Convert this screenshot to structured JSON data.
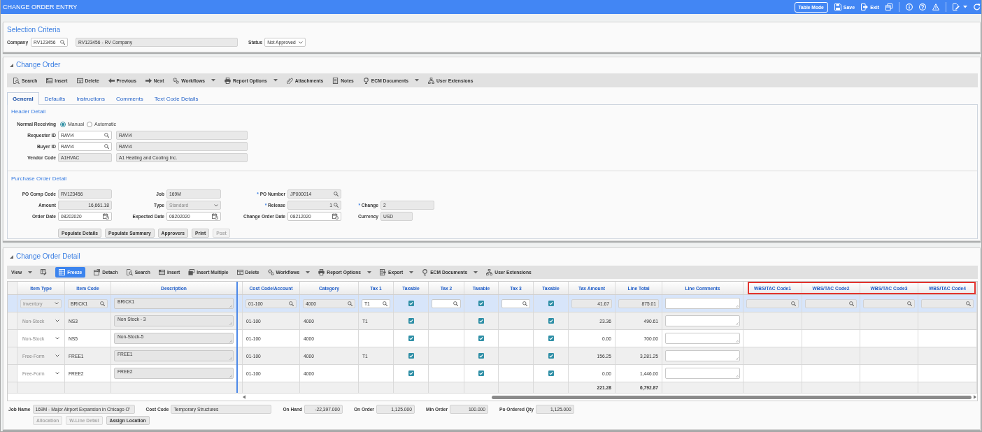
{
  "window": {
    "title": "CHANGE ORDER ENTRY"
  },
  "top_bar": {
    "buttons": [
      {
        "kind": "outlined",
        "label": "Table Mode"
      },
      {
        "kind": "icon-text",
        "label": "Save"
      },
      {
        "kind": "icon-text",
        "label": "Exit"
      }
    ]
  },
  "selection_criteria": {
    "title": "Selection Criteria",
    "company": {
      "label": "Company",
      "value": "RV123456",
      "description": "RV123456 - RV Company"
    },
    "status": {
      "label": "Status",
      "value": "Not Approved"
    }
  },
  "change_order": {
    "title": "Change Order",
    "expanded": true,
    "toolbar": [
      {
        "label": "Search",
        "dropdown": false
      },
      {
        "label": "Insert",
        "dropdown": false
      },
      {
        "label": "Delete",
        "dropdown": false
      },
      {
        "label": "Previous",
        "dropdown": false
      },
      {
        "label": "Next",
        "dropdown": false
      },
      {
        "label": "Workflows",
        "dropdown": true
      },
      {
        "label": "Report Options",
        "dropdown": true
      },
      {
        "label": "Attachments",
        "dropdown": false
      },
      {
        "label": "Notes",
        "dropdown": false
      },
      {
        "label": "ECM Documents",
        "dropdown": true
      },
      {
        "label": "User Extensions",
        "dropdown": false
      }
    ],
    "tabs": [
      {
        "label": "General",
        "selected": true
      },
      {
        "label": "Defaults",
        "selected": false
      },
      {
        "label": "Instructions",
        "selected": false
      },
      {
        "label": "Comments",
        "selected": false
      },
      {
        "label": "Text Code Details",
        "selected": false
      }
    ],
    "header_detail": {
      "title": "Header Detail",
      "normal_receiving": {
        "label": "Normal Receiving",
        "options": [
          {
            "label": "Manual",
            "selected": true
          },
          {
            "label": "Automatic",
            "selected": false
          }
        ]
      },
      "fields": [
        {
          "label": "Requester ID",
          "value": "RAVI4",
          "kind": "lookup",
          "readonly": false,
          "description": "RAVI4"
        },
        {
          "label": "Buyer ID",
          "value": "RAVI4",
          "kind": "lookup",
          "readonly": false,
          "description": "RAVI4"
        },
        {
          "label": "Vendor Code",
          "value": "A1HVAC",
          "kind": "text",
          "readonly": true,
          "description": "A1 Heating and Cooling Inc."
        }
      ]
    },
    "po_detail": {
      "title": "Purchase Order Detail",
      "rows": [
        [
          {
            "label": "PO Comp Code",
            "value": "RV123456",
            "kind": "text",
            "readonly": true
          },
          {
            "label": "Job",
            "value": "169M",
            "kind": "text",
            "readonly": true
          },
          {
            "required_mark": "*",
            "label": "PO Number",
            "value": "JP000014",
            "kind": "lookup",
            "readonly": true
          }
        ],
        [
          {
            "label": "Amount",
            "value": "16,661.18",
            "kind": "amount",
            "readonly": true
          },
          {
            "label": "Type",
            "value": "Standard",
            "kind": "select",
            "readonly": true
          },
          {
            "required_mark": "*",
            "label": "Release",
            "value": "1",
            "kind": "amount-lookup",
            "readonly": true
          },
          {
            "required_mark": "*",
            "label": "Change",
            "value": "2",
            "kind": "text",
            "readonly": true
          }
        ],
        [
          {
            "label": "Order Date",
            "value": "08202020",
            "kind": "date",
            "readonly": false
          },
          {
            "label": "Expected Date",
            "value": "08202020",
            "kind": "date",
            "readonly": false
          },
          {
            "label": "Change Order Date",
            "value": "08212020",
            "kind": "date",
            "readonly": false
          },
          {
            "label": "Currency",
            "value": "USD",
            "kind": "text",
            "readonly": true
          }
        ]
      ],
      "buttons": [
        {
          "label": "Populate Details",
          "disabled": false
        },
        {
          "label": "Populate Summary",
          "disabled": false
        },
        {
          "label": "Approvers",
          "disabled": false
        },
        {
          "label": "Print",
          "disabled": false
        },
        {
          "label": "Post",
          "disabled": true
        }
      ]
    }
  },
  "change_order_detail": {
    "title": "Change Order Detail",
    "expanded": true,
    "toolbar": [
      {
        "kind": "text",
        "label": "View",
        "dropdown": true,
        "active": false
      },
      {
        "kind": "icon",
        "dropdown": false,
        "active": false
      },
      {
        "kind": "icon-text",
        "label": "Freeze",
        "dropdown": false,
        "active": true
      },
      {
        "kind": "icon-text",
        "label": "Detach",
        "dropdown": false,
        "active": false
      },
      {
        "kind": "icon-text",
        "label": "Search",
        "dropdown": false,
        "active": false
      },
      {
        "kind": "icon-text",
        "label": "Insert",
        "dropdown": false,
        "active": false
      },
      {
        "kind": "icon-text",
        "label": "Insert Multiple",
        "dropdown": false,
        "active": false
      },
      {
        "kind": "icon-text",
        "label": "Delete",
        "dropdown": false,
        "active": false
      },
      {
        "kind": "icon-text",
        "label": "Workflows",
        "dropdown": true,
        "active": false
      },
      {
        "kind": "icon-text",
        "label": "Report Options",
        "dropdown": true,
        "active": false
      },
      {
        "kind": "icon-text",
        "label": "Export",
        "dropdown": true,
        "active": false
      },
      {
        "kind": "icon-text",
        "label": "ECM Documents",
        "dropdown": true,
        "active": false
      },
      {
        "kind": "icon-text",
        "label": "User Extensions",
        "dropdown": false,
        "active": false
      }
    ],
    "table": {
      "columns": [
        {
          "label": "Item Type",
          "highlighted": false
        },
        {
          "label": "Item Code",
          "highlighted": false
        },
        {
          "label": "Description",
          "highlighted": false
        },
        {
          "label": "Cost Code/Account",
          "highlighted": false
        },
        {
          "label": "Category",
          "highlighted": false
        },
        {
          "label": "Tax 1",
          "highlighted": false
        },
        {
          "label": "Taxable",
          "highlighted": false
        },
        {
          "label": "Tax 2",
          "highlighted": false
        },
        {
          "label": "Taxable",
          "highlighted": false
        },
        {
          "label": "Tax 3",
          "highlighted": false
        },
        {
          "label": "Taxable",
          "highlighted": false
        },
        {
          "label": "Tax Amount",
          "highlighted": false
        },
        {
          "label": "Line Total",
          "highlighted": false
        },
        {
          "label": "Line Comments",
          "highlighted": false
        },
        {
          "label": "WBS/TAC Code1",
          "highlighted": true
        },
        {
          "label": "WBS/TAC Code2",
          "highlighted": true
        },
        {
          "label": "WBS/TAC Code3",
          "highlighted": true
        },
        {
          "label": "WBS/TAC Code4",
          "highlighted": true
        }
      ],
      "rows": [
        {
          "selected": true,
          "item_type": "Inventory",
          "item_code": "BRICK1",
          "description": "BRICK1",
          "cost_code": "01-100",
          "category": "4000",
          "tax_1": "T1",
          "taxable_1": true,
          "taxable_2": true,
          "taxable_3": true,
          "tax_amount": "41.67",
          "line_total": "875.01"
        },
        {
          "selected": false,
          "item_type": "Non-Stock",
          "item_code": "NS3",
          "description": "Non Stock - 3",
          "cost_code": "01-100",
          "category": "4000",
          "tax_1": "T1",
          "taxable_1": true,
          "taxable_2": true,
          "taxable_3": true,
          "tax_amount": "23.36",
          "line_total": "490.61"
        },
        {
          "selected": false,
          "item_type": "Non-Stock",
          "item_code": "NS5",
          "description": "Non-Stock-5",
          "cost_code": "01-100",
          "category": "4000",
          "taxable_1": true,
          "taxable_2": true,
          "taxable_3": true,
          "tax_amount": "0.00",
          "line_total": "700.00"
        },
        {
          "selected": false,
          "item_type": "Free-Form",
          "item_code": "FREE1",
          "description": "FREE1",
          "cost_code": "01-100",
          "category": "4000",
          "tax_1": "T1",
          "taxable_1": true,
          "taxable_2": true,
          "taxable_3": true,
          "tax_amount": "156.25",
          "line_total": "3,281.25"
        },
        {
          "selected": false,
          "item_type": "Free-Form",
          "item_code": "FREE2",
          "description": "FREE2",
          "cost_code": "01-100",
          "category": "4000",
          "taxable_1": true,
          "taxable_2": true,
          "taxable_3": true,
          "tax_amount": "0.00",
          "line_total": "1,446.00"
        }
      ],
      "totals": {
        "tax_amount": "221.28",
        "line_total": "6,792.87"
      }
    },
    "line_info": {
      "fields": [
        {
          "label": "Job Name",
          "value": "169M - Major Airport Expansion in Chicago O'",
          "kind": "text"
        },
        {
          "label": "Cost Code",
          "value": "Temporary Structures",
          "kind": "text"
        },
        {
          "label": "On Hand",
          "value": "-22,397.000",
          "kind": "amount"
        },
        {
          "label": "On Order",
          "value": "1,125.000",
          "kind": "amount"
        },
        {
          "label": "Min Order",
          "value": "100.000",
          "kind": "amount"
        },
        {
          "label": "Po Ordered Qty",
          "value": "1,125.000",
          "kind": "amount"
        }
      ],
      "buttons": [
        {
          "label": "Allocation",
          "disabled": true
        },
        {
          "label": "W-Line Detail",
          "disabled": true
        },
        {
          "label": "Assign Location",
          "disabled": false
        }
      ]
    }
  }
}
